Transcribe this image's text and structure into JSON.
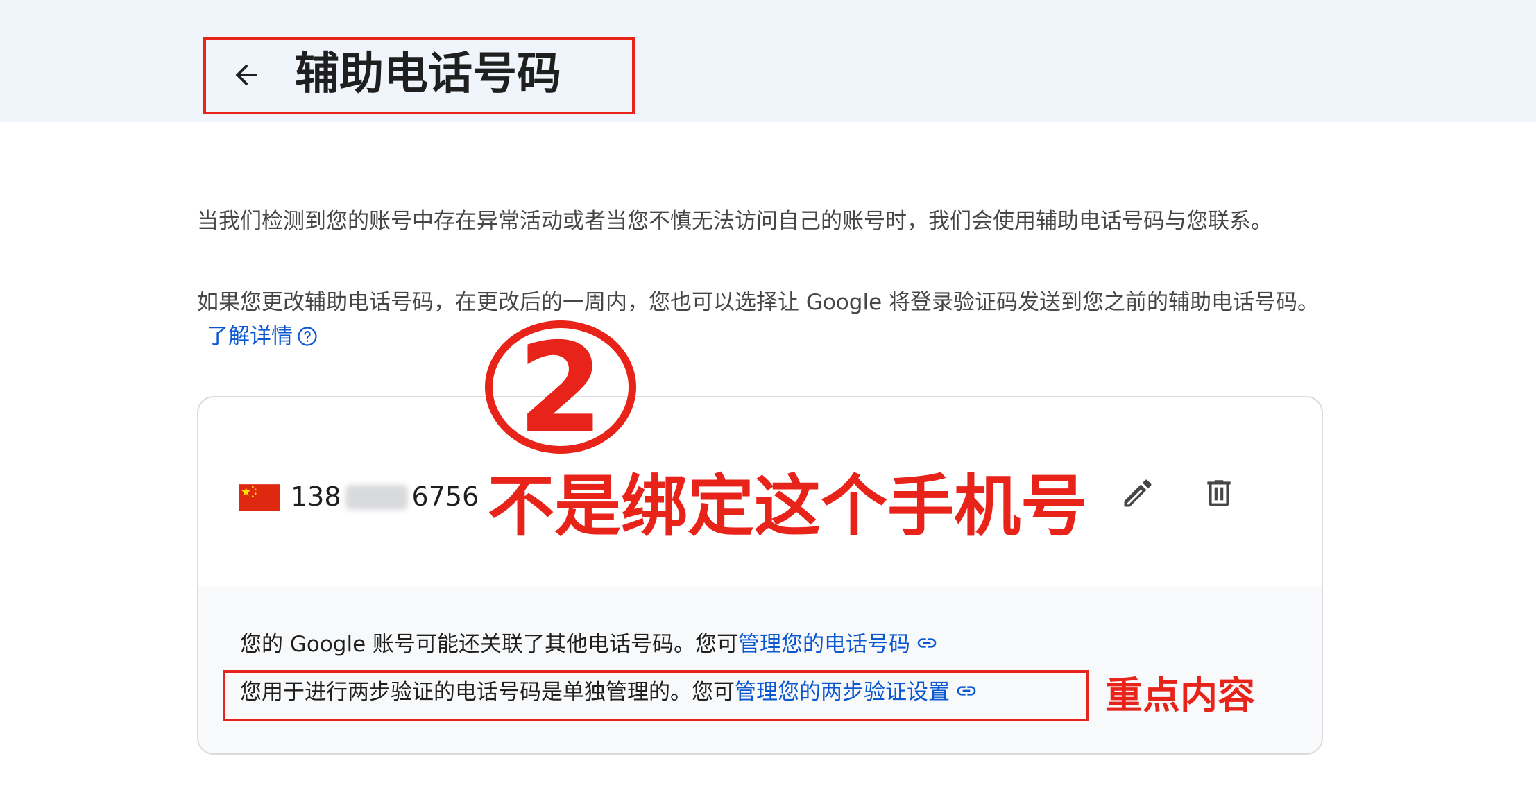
{
  "header": {
    "title": "辅助电话号码",
    "back_icon": "arrow-left-icon"
  },
  "description": {
    "paragraph1": "当我们检测到您的账号中存在异常活动或者当您不慎无法访问自己的账号时，我们会使用辅助电话号码与您联系。",
    "paragraph2": "如果您更改辅助电话号码，在更改后的一周内，您也可以选择让 Google 将登录验证码发送到您之前的辅助电话号码。",
    "learn_more_link": "了解详情",
    "help_icon": "help-circle-icon"
  },
  "phone_card": {
    "flag_icon": "china-flag-icon",
    "number_prefix": "138",
    "number_suffix": "6756",
    "edit_icon": "pencil-icon",
    "delete_icon": "trash-icon",
    "footer": {
      "line1_text": "您的 Google 账号可能还关联了其他电话号码。您可",
      "line1_link": "管理您的电话号码",
      "line2_text": "您用于进行两步验证的电话号码是单独管理的。您可",
      "line2_link": "管理您的两步验证设置",
      "link_icon": "link-icon"
    }
  },
  "annotations": {
    "step_number": "2",
    "phone_note": "不是绑定这个手机号",
    "key_note": "重点内容",
    "color": "#e8231a"
  },
  "colors": {
    "header_bg": "#f0f4fb",
    "link": "#0b57d0",
    "annotation": "#e8231a"
  }
}
